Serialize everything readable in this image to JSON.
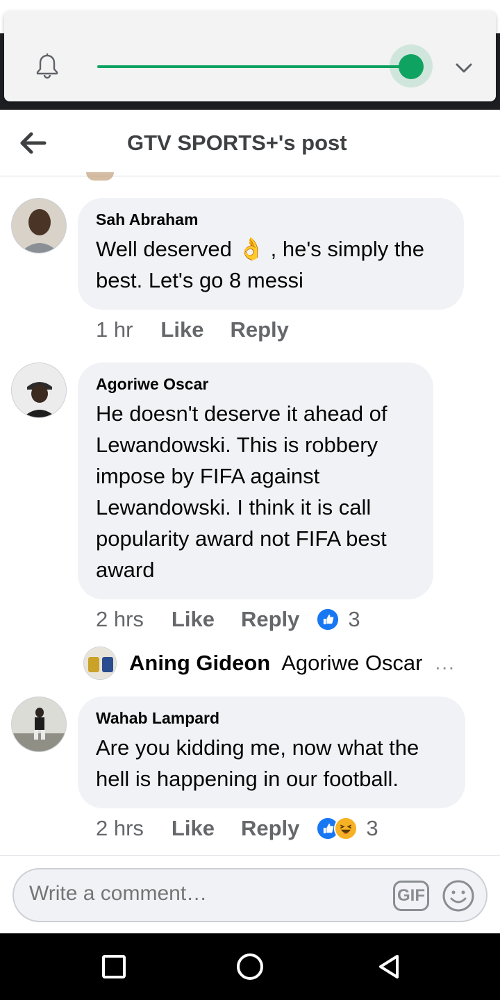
{
  "header": {
    "title": "GTV SPORTS+'s post"
  },
  "comments": [
    {
      "author": "Sah Abraham",
      "text": "Well deserved 👌 , he's simply the best. Let's go 8 messi",
      "time": "1 hr",
      "like_label": "Like",
      "reply_label": "Reply"
    },
    {
      "author": "Agoriwe Oscar",
      "text": "He doesn't deserve it ahead of Lewandowski. This is robbery impose by FIFA against Lewandowski. I think it is call popularity award not FIFA best award",
      "time": "2 hrs",
      "like_label": "Like",
      "reply_label": "Reply",
      "reaction_count": "3"
    },
    {
      "author": "Wahab Lampard",
      "text": "Are you kidding me, now what the hell is happening in our football.",
      "time": "2 hrs",
      "like_label": "Like",
      "reply_label": "Reply",
      "reaction_count": "3"
    }
  ],
  "reply_preview": {
    "author": "Aning Gideon",
    "text": "Agoriwe Oscar",
    "more": "..."
  },
  "composer": {
    "placeholder": "Write a comment…",
    "gif_label": "GIF"
  },
  "volume": {
    "level": 1.0
  },
  "colors": {
    "accent": "#0fa361",
    "like_blue": "#1877f2",
    "bubble": "#f0f2f5"
  }
}
